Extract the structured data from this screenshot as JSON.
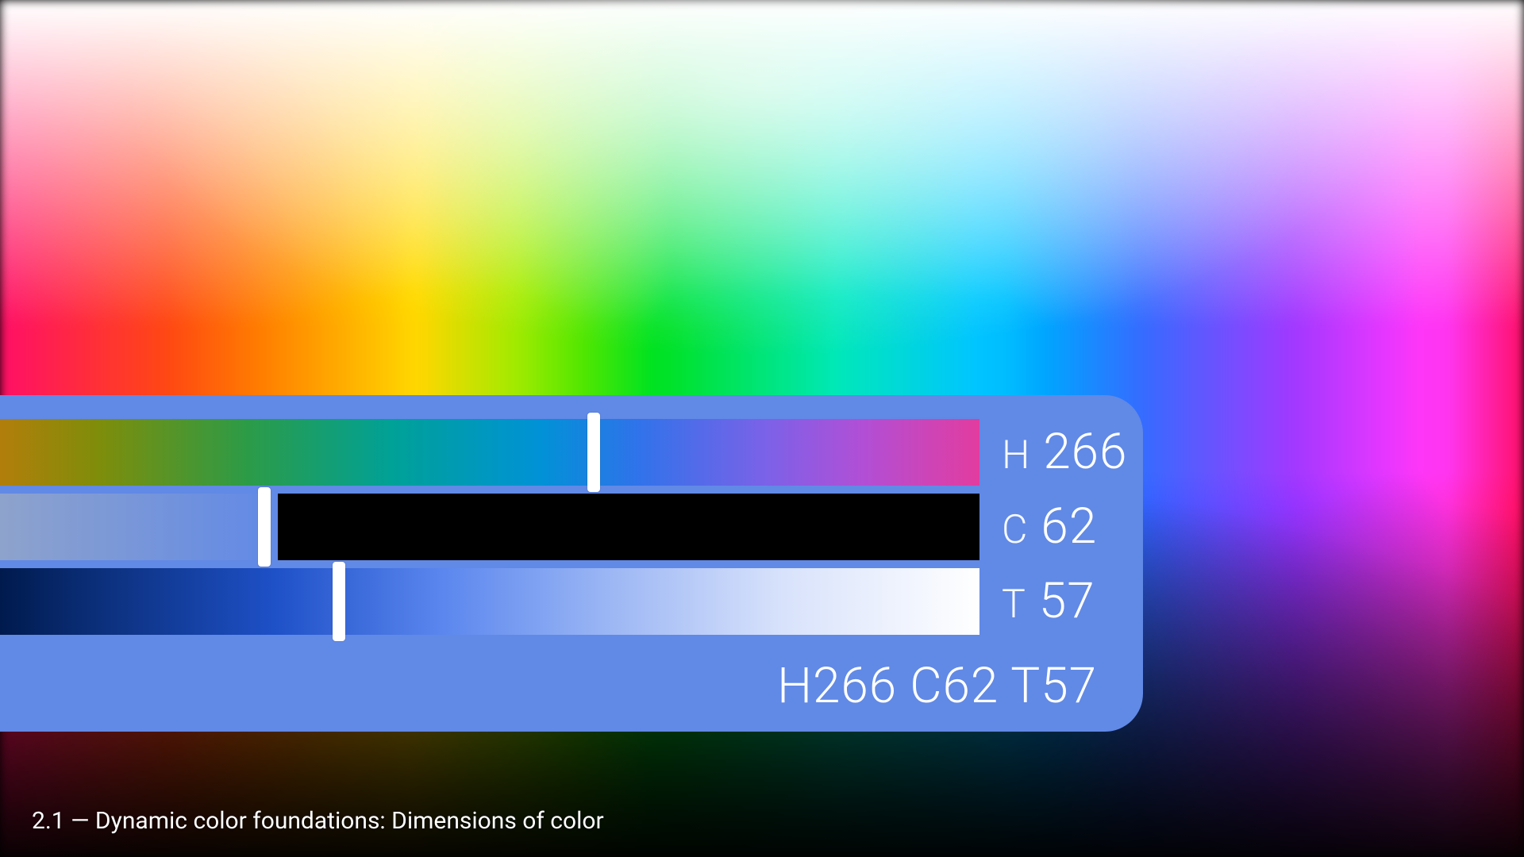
{
  "caption": "2.1 — Dynamic color foundations: Dimensions of color",
  "panel": {
    "bg": "#6189e6"
  },
  "hct": {
    "h": {
      "label": "H",
      "value": 266,
      "min": 0,
      "max": 360,
      "thumb_pct": 60.6
    },
    "c": {
      "label": "C",
      "value": 62,
      "min": 0,
      "max": 150,
      "thumb_pct": 27.0,
      "clamp_from_pct": 28.4
    },
    "t": {
      "label": "T",
      "value": 57,
      "min": 0,
      "max": 100,
      "thumb_pct": 34.6
    }
  },
  "summary": "H266  C62  T57"
}
